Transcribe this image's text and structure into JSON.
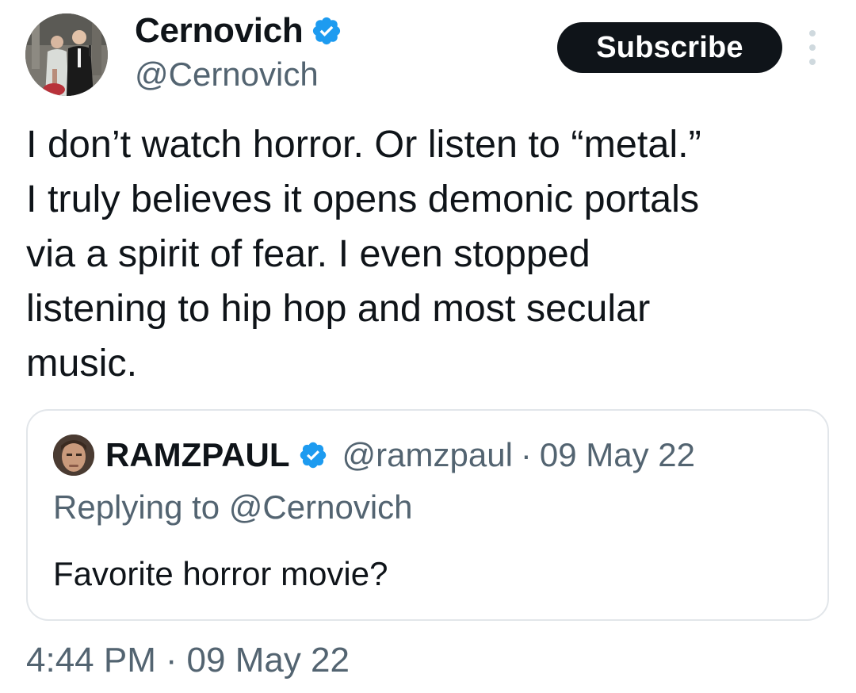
{
  "author": {
    "display_name": "Cernovich",
    "handle": "@Cernovich",
    "verified_icon": "verified-badge-icon",
    "avatar_icon": "avatar-photo"
  },
  "actions": {
    "subscribe_label": "Subscribe",
    "more_icon": "vertical-ellipsis-icon"
  },
  "tweet": {
    "text": "I don’t watch horror. Or listen to “metal.”\nI truly believes it opens demonic portals\nvia a spirit of fear. I even stopped\nlistening to hip hop and most secular\nmusic."
  },
  "quoted_tweet": {
    "display_name": "RAMZPAUL",
    "handle": "@ramzpaul",
    "separator": "·",
    "date": "09 May 22",
    "replying_to": "Replying to @Cernovich",
    "text": "Favorite horror movie?"
  },
  "footer": {
    "time": "4:44 PM",
    "separator": "·",
    "date": "09 May 22"
  },
  "colors": {
    "text_primary": "#0f1419",
    "text_secondary": "#536471",
    "verified_blue": "#1d9bf0",
    "button_bg": "#0f1419",
    "card_border": "#e2e6ea"
  }
}
